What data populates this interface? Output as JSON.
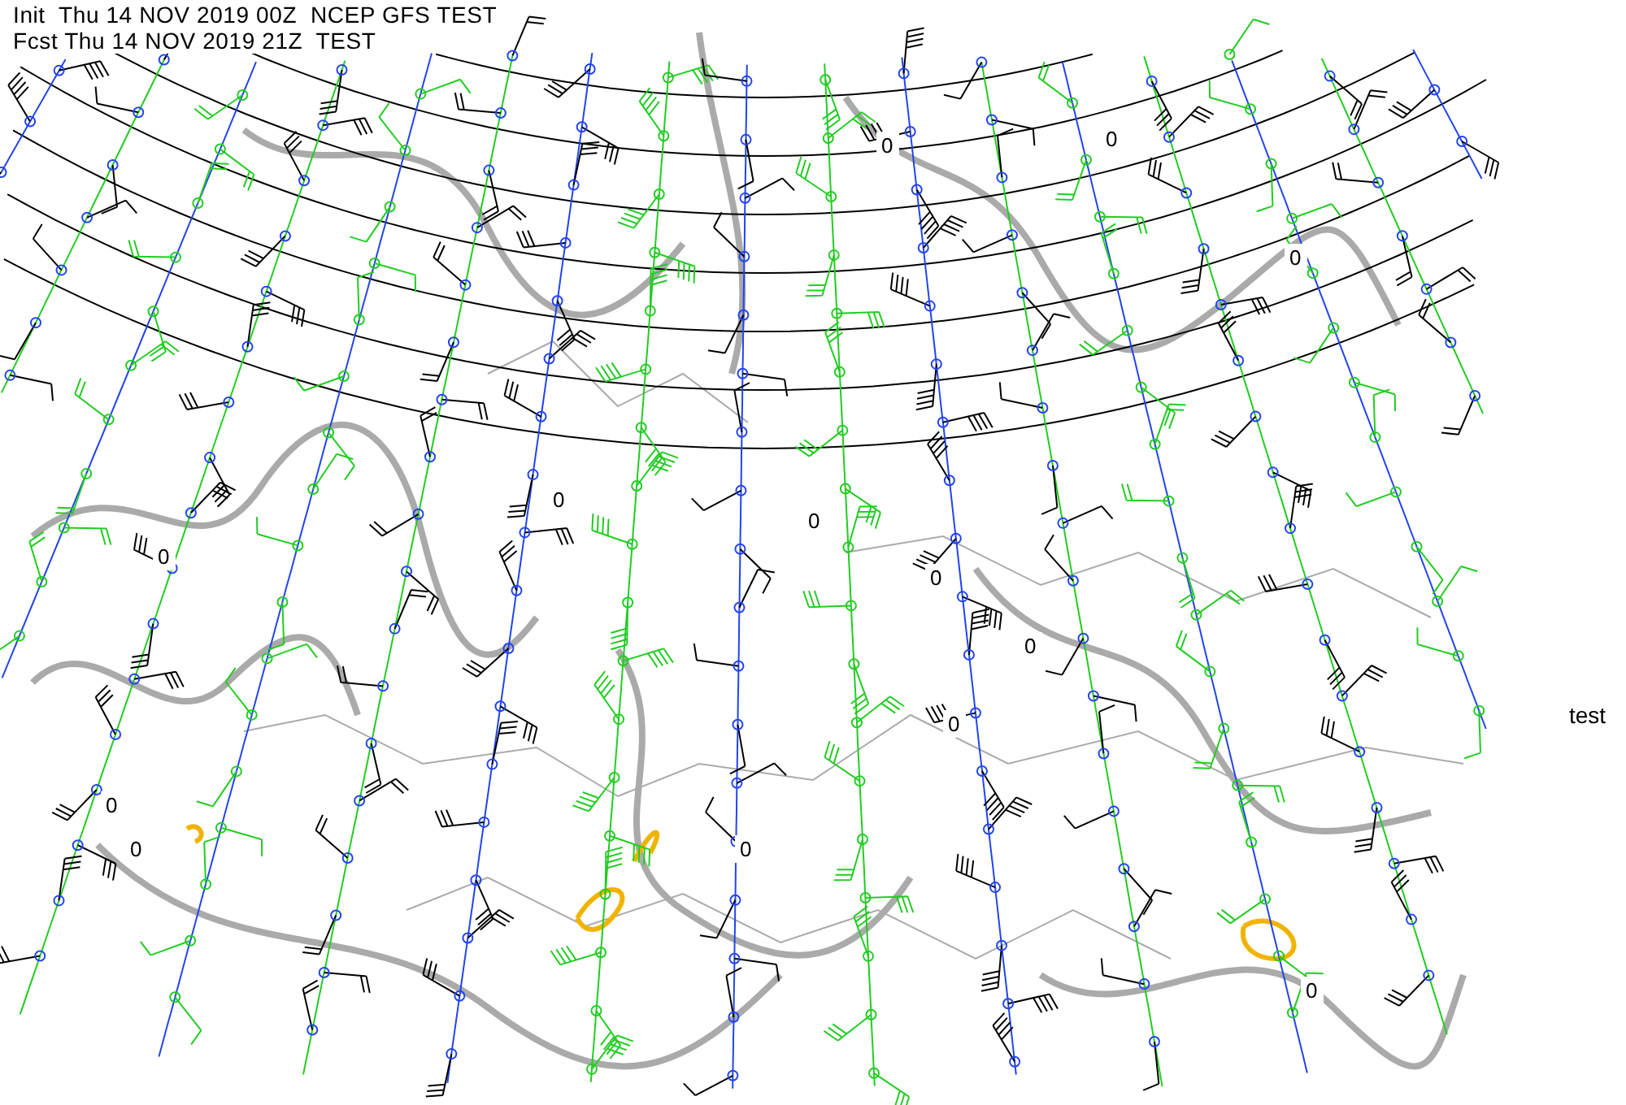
{
  "header": {
    "init_line": "Init  Thu 14 NOV 2019 00Z  NCEP GFS TEST",
    "forecast_line": "Fcst Thu 14 NOV 2019 21Z  TEST"
  },
  "map": {
    "contour_labels": [
      "0",
      "0",
      "0",
      "0",
      "0",
      "0",
      "0",
      "0",
      "0",
      "0",
      "0",
      "0",
      "0"
    ]
  },
  "side_label": "test"
}
